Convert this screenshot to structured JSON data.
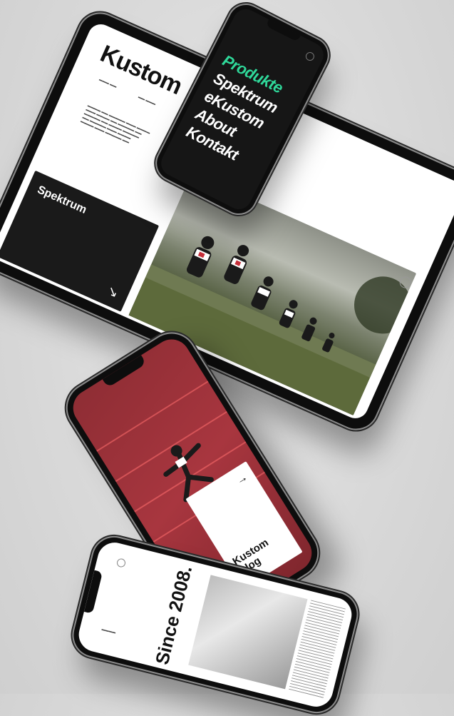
{
  "tablet": {
    "logo": "Kustom",
    "block_label": "Spektrum",
    "arrow_icon": "arrow-down-right-icon"
  },
  "phone_menu": {
    "items": [
      {
        "label": "Produkte",
        "active": true
      },
      {
        "label": "Spektrum",
        "active": false
      },
      {
        "label": "eKustom",
        "active": false
      },
      {
        "label": "About",
        "active": false
      },
      {
        "label": "Kontakt",
        "active": false
      }
    ],
    "accent_color": "#2fd89a"
  },
  "phone_blog": {
    "title_line1": "Kustom",
    "title_line2": "Blog",
    "arrow_icon": "arrow-right-icon",
    "background_color": "#a8363f"
  },
  "phone_since": {
    "headline": "Since 2008."
  }
}
